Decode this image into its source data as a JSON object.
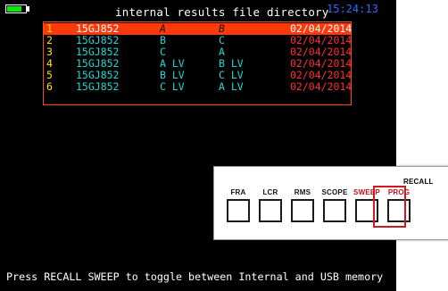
{
  "header": {
    "title": "internal results file directory",
    "clock": "15:24:13",
    "battery_level_fraction": 0.8,
    "battery_color": "#00ee00"
  },
  "files": [
    {
      "num": "1",
      "id": "15GJ852",
      "ch_a": "A",
      "ch_b": "B",
      "date": "02/04/2014",
      "selected": true
    },
    {
      "num": "2",
      "id": "15GJ852",
      "ch_a": "B",
      "ch_b": "C",
      "date": "02/04/2014",
      "selected": false
    },
    {
      "num": "3",
      "id": "15GJ852",
      "ch_a": "C",
      "ch_b": "A",
      "date": "02/04/2014",
      "selected": false
    },
    {
      "num": "4",
      "id": "15GJ852",
      "ch_a": "A LV",
      "ch_b": "B LV",
      "date": "02/04/2014",
      "selected": false
    },
    {
      "num": "5",
      "id": "15GJ852",
      "ch_a": "B LV",
      "ch_b": "C LV",
      "date": "02/04/2014",
      "selected": false
    },
    {
      "num": "6",
      "id": "15GJ852",
      "ch_a": "C LV",
      "ch_b": "A LV",
      "date": "02/04/2014",
      "selected": false
    }
  ],
  "status_bar": {
    "message": "Press RECALL SWEEP to toggle between Internal and USB memory"
  },
  "keypad": {
    "group_label": "RECALL",
    "buttons": [
      {
        "label": "FRA",
        "active": false
      },
      {
        "label": "LCR",
        "active": false
      },
      {
        "label": "RMS",
        "active": false
      },
      {
        "label": "SCOPE",
        "active": false
      },
      {
        "label": "SWEEP",
        "active": true
      },
      {
        "label": "PROG",
        "active": true
      }
    ]
  },
  "colors": {
    "screen_background": "#000000",
    "selection_highlight": "#ff3a0a",
    "table_border": "#ff4a1a",
    "row_number": "#ffe200",
    "identifier_text": "#22d6d6",
    "date_text": "#ff3030",
    "clock_text": "#2f6bff",
    "active_key_label": "#c0101a"
  }
}
